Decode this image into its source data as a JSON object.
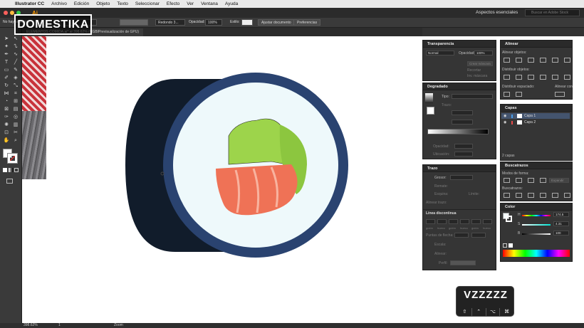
{
  "menubar": {
    "app_name": "Illustrator CC",
    "items": [
      "Archivo",
      "Edición",
      "Objeto",
      "Texto",
      "Seleccionar",
      "Efecto",
      "Ver",
      "Ventana",
      "Ayuda"
    ]
  },
  "appbar": {
    "logo": "Ai",
    "workspace": "Aspectos esenciales",
    "search_placeholder": "Buscar en Adobe Stock"
  },
  "control_bar": {
    "selection": "No hay selección",
    "stroke_style": "Redondo 3...",
    "opacity_label": "Opacidad:",
    "opacity_value": "100%",
    "style_label": "Estilo:",
    "adjust_button": "Ajustar documento",
    "prefs_button": "Preferencias"
  },
  "document_tab": {
    "label": "ELEMENTOS COMIDA.ai* al 398.62% (RGB/Previsualización de GPU)"
  },
  "overlay": {
    "brand": "DOMESTIKA"
  },
  "transparency_panel": {
    "title": "Transparencia",
    "blend_mode": "Normal",
    "opacity_label": "Opacidad:",
    "opacity_value": "100%",
    "make_mask": "Crear máscara",
    "clip": "Recortar",
    "invert": "Inv. máscara"
  },
  "gradient_panel": {
    "title": "Degradado",
    "type_label": "Tipo:",
    "stroke_label": "Trazo:",
    "opacity_label": "Opacidad:",
    "location_label": "Ubicación:"
  },
  "stroke_panel": {
    "title": "Trazo",
    "weight_label": "Grosor:",
    "cap_label": "Remate:",
    "corner_label": "Esquina:",
    "limit_label": "Límite:",
    "align_label": "Alinear trazo:",
    "dashed_label": "Línea discontinua",
    "dash_labels": [
      "guión",
      "hueco",
      "guión",
      "hueco",
      "guión",
      "hueco"
    ],
    "arrow_label": "Puntas de flecha:",
    "scale_label": "Escala:",
    "align_arrow_label": "Alinear:",
    "profile_label": "Perfil:"
  },
  "align_panel": {
    "title": "Alinear",
    "align_objects": "Alinear objetos:",
    "distribute_objects": "Distribuir objetos:",
    "distribute_spacing": "Distribuir espaciado:",
    "align_to": "Alinear con:"
  },
  "layers_panel": {
    "title": "Capas",
    "layers": [
      "Capa 1",
      "Capa 2"
    ],
    "count": "2 capas"
  },
  "pathfinder_panel": {
    "title": "Buscatrazos",
    "shape_modes": "Modos de forma:",
    "expand": "Expandir",
    "pathfinders": "Buscatrazos:"
  },
  "color_panel": {
    "title": "Color",
    "h_label": "H",
    "h_value": "174.5",
    "s_label": "S",
    "s_value": "4.31",
    "b_label": "B",
    "b_value": "100"
  },
  "keycast": {
    "keys": "VZZZZZ",
    "mods": [
      "⇧",
      "⌃",
      "⌥",
      "⌘"
    ]
  },
  "statusbar": {
    "zoom": "398.62%",
    "artboard": "1",
    "tool": "Zoom"
  },
  "colors": {
    "sushi_dark": "#111c2b",
    "nori_blue": "#2a4370",
    "rice": "#eef9fb",
    "salmon": "#ef7256",
    "lettuce": "#9dd44b",
    "accent_orange": "#ff9a00"
  }
}
